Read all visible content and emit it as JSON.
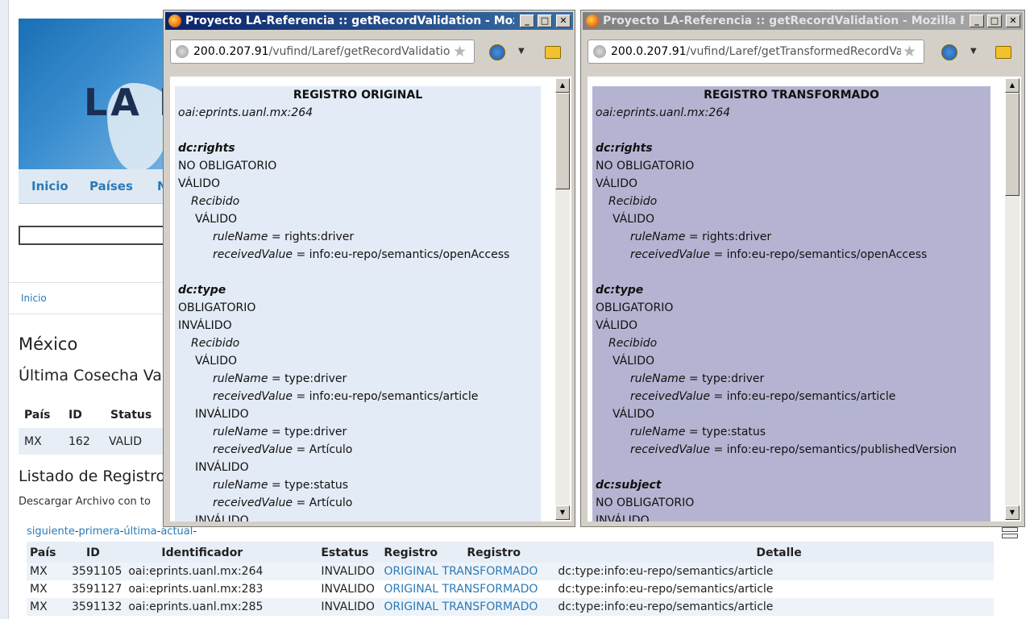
{
  "background": {
    "logo_text": "LA R",
    "nav": [
      "Inicio",
      "Países",
      "N"
    ],
    "breadcrumb": "Inicio",
    "country_heading": "México",
    "harvest_heading": "Última Cosecha Va",
    "summary_headers": [
      "País",
      "ID",
      "Status"
    ],
    "summary_row": [
      "MX",
      "162",
      "VALID"
    ],
    "list_heading": "Listado de Registro",
    "download_text": "Descargar Archivo con to",
    "pager": [
      "siguiente",
      "primera",
      "última",
      "actual"
    ],
    "table": {
      "headers": [
        "País",
        "ID",
        "Identificador",
        "Estatus",
        "Registro",
        "Registro",
        "Detalle"
      ],
      "rows": [
        {
          "pais": "MX",
          "id": "3591105",
          "identificador": "oai:eprints.uanl.mx:264",
          "estatus": "INVALIDO",
          "original": "ORIGINAL",
          "transformado": "TRANSFORMADO",
          "detalle": "dc:type:info:eu-repo/semantics/article"
        },
        {
          "pais": "MX",
          "id": "3591127",
          "identificador": "oai:eprints.uanl.mx:283",
          "estatus": "INVALIDO",
          "original": "ORIGINAL",
          "transformado": "TRANSFORMADO",
          "detalle": "dc:type:info:eu-repo/semantics/article"
        },
        {
          "pais": "MX",
          "id": "3591132",
          "identificador": "oai:eprints.uanl.mx:285",
          "estatus": "INVALIDO",
          "original": "ORIGINAL",
          "transformado": "TRANSFORMADO",
          "detalle": "dc:type:info:eu-repo/semantics/article"
        }
      ]
    }
  },
  "window_original": {
    "title": "Proyecto LA-Referencia :: getRecordValidation - Moz...",
    "url_host": "200.0.207.91",
    "url_path": "/vufind/Laref/getRecordValidation",
    "heading": "REGISTRO ORIGINAL",
    "oai_id": "oai:eprints.uanl.mx:264",
    "background_color": "#e3ebf6",
    "fields": [
      {
        "name": "dc:rights",
        "requirement": "NO OBLIGATORIO",
        "status": "VÁLIDO",
        "received_label": "Recibido",
        "checks": [
          {
            "status": "VÁLIDO",
            "rule_label": "ruleName",
            "rule_value": "= rights:driver",
            "value_label": "receivedValue",
            "value": "= info:eu-repo/semantics/openAccess"
          }
        ]
      },
      {
        "name": "dc:type",
        "requirement": "OBLIGATORIO",
        "status": "INVÁLIDO",
        "received_label": "Recibido",
        "checks": [
          {
            "status": "VÁLIDO",
            "rule_label": "ruleName",
            "rule_value": "= type:driver",
            "value_label": "receivedValue",
            "value": "= info:eu-repo/semantics/article"
          },
          {
            "status": "INVÁLIDO",
            "rule_label": "ruleName",
            "rule_value": "= type:driver",
            "value_label": "receivedValue",
            "value": "= Artículo"
          },
          {
            "status": "INVÁLIDO",
            "rule_label": "ruleName",
            "rule_value": "= type:status",
            "value_label": "receivedValue",
            "value": "= Artículo"
          }
        ],
        "trailing_status": "INVÁLIDO"
      }
    ]
  },
  "window_transformed": {
    "title": "Proyecto LA-Referencia :: getRecordValidation - Mozilla Fi...",
    "url_host": "200.0.207.91",
    "url_path": "/vufind/Laref/getTransformedRecordVali",
    "heading": "REGISTRO TRANSFORMADO",
    "oai_id": "oai:eprints.uanl.mx:264",
    "background_color": "#b4b4d2",
    "fields": [
      {
        "name": "dc:rights",
        "requirement": "NO OBLIGATORIO",
        "status": "VÁLIDO",
        "received_label": "Recibido",
        "checks": [
          {
            "status": "VÁLIDO",
            "rule_label": "ruleName",
            "rule_value": "= rights:driver",
            "value_label": "receivedValue",
            "value": "= info:eu-repo/semantics/openAccess"
          }
        ]
      },
      {
        "name": "dc:type",
        "requirement": "OBLIGATORIO",
        "status": "VÁLIDO",
        "received_label": "Recibido",
        "checks": [
          {
            "status": "VÁLIDO",
            "rule_label": "ruleName",
            "rule_value": "= type:driver",
            "value_label": "receivedValue",
            "value": "= info:eu-repo/semantics/article"
          },
          {
            "status": "VÁLIDO",
            "rule_label": "ruleName",
            "rule_value": "= type:status",
            "value_label": "receivedValue",
            "value": "= info:eu-repo/semantics/publishedVersion"
          }
        ]
      },
      {
        "name": "dc:subject",
        "requirement": "NO OBLIGATORIO",
        "status": "INVÁLIDO",
        "checks": []
      }
    ]
  },
  "icons": {
    "window_icon": "firefox-icon",
    "globe": "site-identity-icon",
    "star": "bookmark-star-icon",
    "addon": "addon-icon",
    "rss": "rss-icon"
  }
}
